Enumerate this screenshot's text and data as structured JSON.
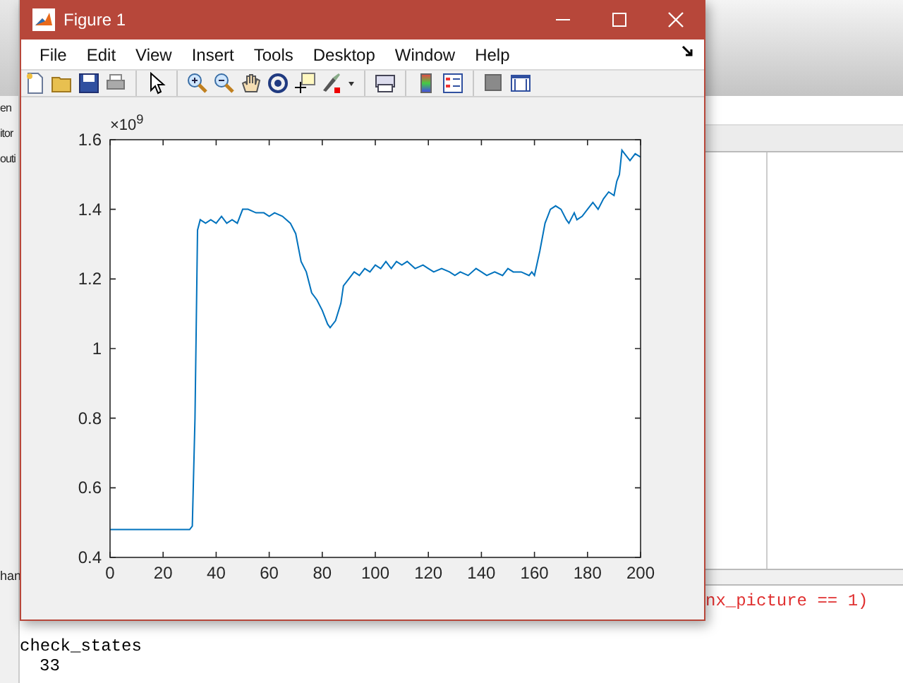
{
  "background": {
    "side_labels": [
      "en",
      "itor",
      "outi"
    ],
    "panel_label": "han",
    "code_line": "nx_picture == 1)",
    "command": "check_states",
    "output": "33"
  },
  "window": {
    "title": "Figure 1"
  },
  "menu": [
    "File",
    "Edit",
    "View",
    "Insert",
    "Tools",
    "Desktop",
    "Window",
    "Help"
  ],
  "axes": {
    "exponent": "×10$^{9}$",
    "chart_data": {
      "type": "line",
      "x": [
        0,
        10,
        20,
        30,
        31,
        32,
        33,
        34,
        36,
        38,
        40,
        42,
        44,
        46,
        48,
        50,
        52,
        55,
        58,
        60,
        62,
        65,
        68,
        70,
        72,
        74,
        76,
        78,
        80,
        82,
        83,
        85,
        87,
        88,
        90,
        92,
        94,
        96,
        98,
        100,
        102,
        104,
        106,
        108,
        110,
        112,
        115,
        118,
        120,
        122,
        125,
        128,
        130,
        132,
        135,
        138,
        140,
        142,
        145,
        148,
        150,
        152,
        155,
        158,
        159,
        160,
        162,
        164,
        165,
        166,
        168,
        170,
        172,
        173,
        175,
        176,
        178,
        180,
        182,
        184,
        186,
        188,
        190,
        191,
        192,
        193,
        194,
        196,
        198,
        200
      ],
      "series": [
        {
          "color": "#0072bd",
          "values": [
            0.48,
            0.48,
            0.48,
            0.48,
            0.49,
            0.8,
            1.34,
            1.37,
            1.36,
            1.37,
            1.36,
            1.38,
            1.36,
            1.37,
            1.36,
            1.4,
            1.4,
            1.39,
            1.39,
            1.38,
            1.39,
            1.38,
            1.36,
            1.33,
            1.25,
            1.22,
            1.16,
            1.14,
            1.11,
            1.07,
            1.06,
            1.08,
            1.13,
            1.18,
            1.2,
            1.22,
            1.21,
            1.23,
            1.22,
            1.24,
            1.23,
            1.25,
            1.23,
            1.25,
            1.24,
            1.25,
            1.23,
            1.24,
            1.23,
            1.22,
            1.23,
            1.22,
            1.21,
            1.22,
            1.21,
            1.23,
            1.22,
            1.21,
            1.22,
            1.21,
            1.23,
            1.22,
            1.22,
            1.21,
            1.22,
            1.21,
            1.28,
            1.36,
            1.38,
            1.4,
            1.41,
            1.4,
            1.37,
            1.36,
            1.39,
            1.37,
            1.38,
            1.4,
            1.42,
            1.4,
            1.43,
            1.45,
            1.44,
            1.48,
            1.5,
            1.57,
            1.56,
            1.54,
            1.56,
            1.55
          ]
        }
      ],
      "xlim": [
        0,
        200
      ],
      "ylim": [
        0.4,
        1.6
      ],
      "xticks": [
        0,
        20,
        40,
        60,
        80,
        100,
        120,
        140,
        160,
        180,
        200
      ],
      "yticks": [
        0.4,
        0.6,
        0.8,
        1,
        1.2,
        1.4,
        1.6
      ]
    }
  }
}
